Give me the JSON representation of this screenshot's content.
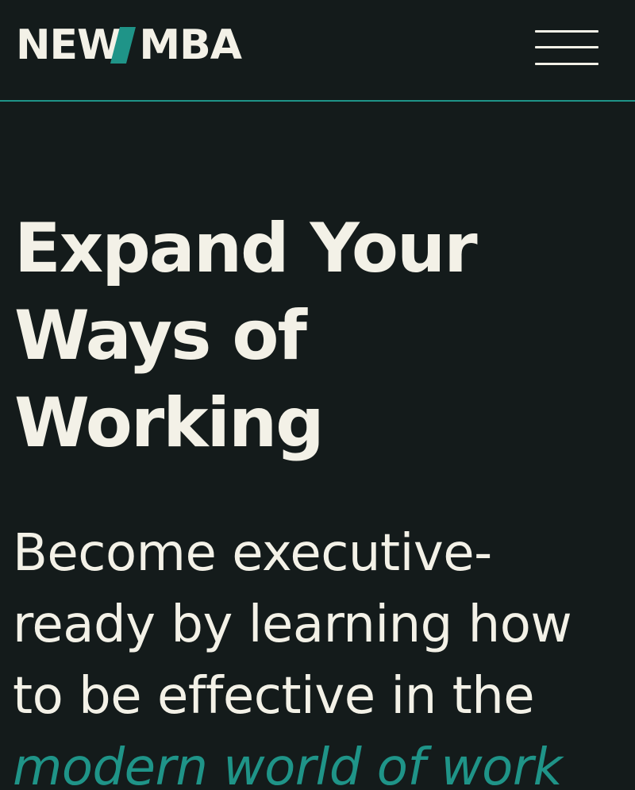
{
  "brand": {
    "logo_left": "NEW",
    "logo_right": "MBA",
    "accent_color": "#1f9488",
    "text_color": "#f3f1e7",
    "background_color": "#141b1b"
  },
  "header": {
    "menu_icon": "hamburger-menu-icon"
  },
  "hero": {
    "title_lines": [
      "Expand Your",
      "Ways of",
      "Working"
    ],
    "subtitle_lines": [
      "Become executive-",
      "ready by learning how",
      "to be effective in the"
    ],
    "subtitle_accent": "modern world of work"
  }
}
